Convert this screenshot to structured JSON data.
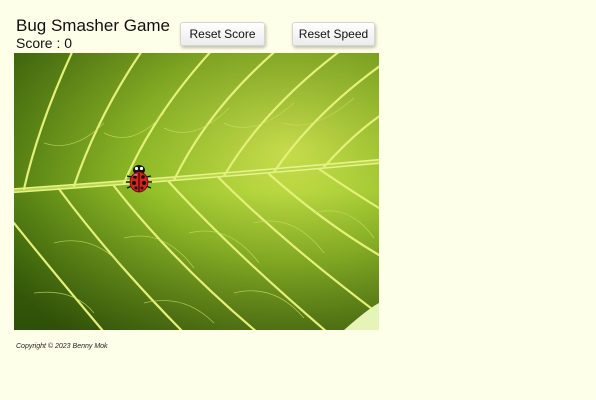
{
  "game": {
    "title": "Bug Smasher Game",
    "score_text": "Score : 0",
    "score_value": 0
  },
  "buttons": {
    "reset_score": "Reset Score",
    "reset_speed": "Reset Speed"
  },
  "board": {
    "background": "leaf-image",
    "bug": "ladybug-icon"
  },
  "footer": {
    "copyright": "Copyright © 2023  Benny Mok"
  },
  "colors": {
    "page_background": "#fdffe8",
    "leaf_light": "#c8e24a",
    "leaf_dark": "#3f6b0a",
    "ladybug_red": "#d8231c"
  }
}
